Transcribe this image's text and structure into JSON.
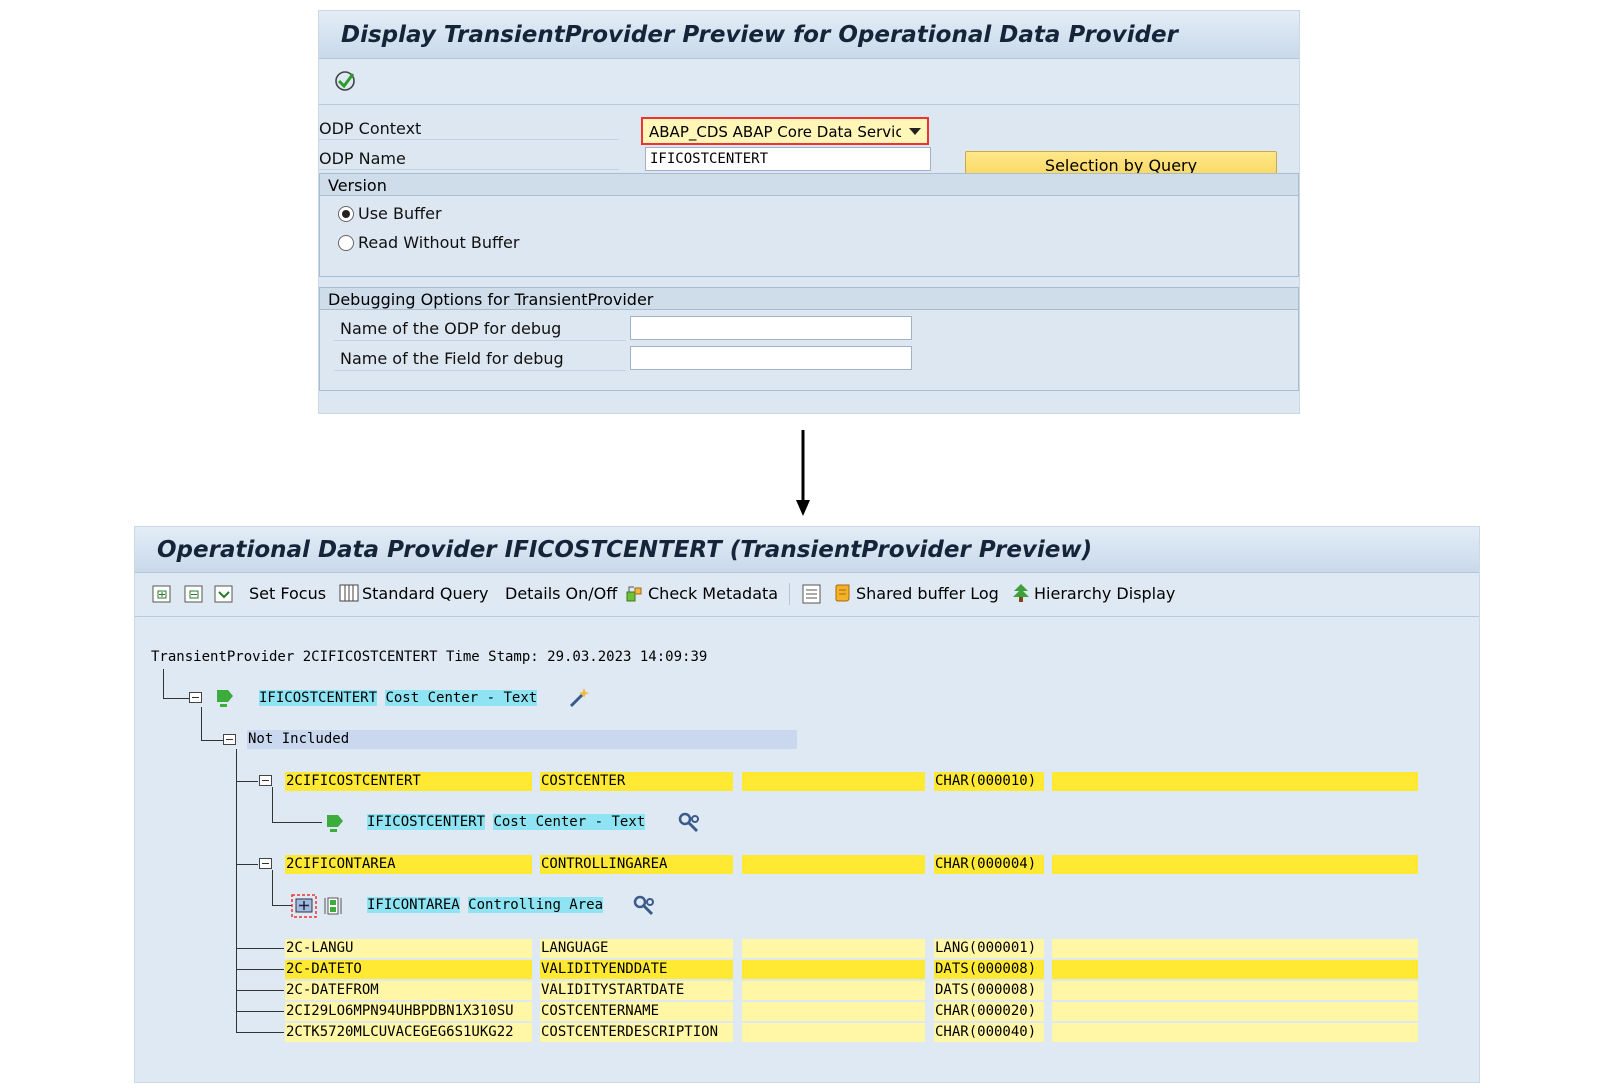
{
  "screen1": {
    "title": "Display TransientProvider Preview for Operational Data Provider",
    "toolbar": {
      "execute_icon": "execute-icon"
    },
    "odp_context": {
      "label": "ODP Context",
      "value": "ABAP_CDS ABAP Core Data Servic..."
    },
    "odp_name": {
      "label": "ODP Name",
      "value": "IFICOSTCENTERT"
    },
    "selection_button": "Selection by Query",
    "version": {
      "title": "Version",
      "options": [
        "Use Buffer",
        "Read Without Buffer"
      ],
      "selected": "Use Buffer"
    },
    "debug": {
      "title": "Debugging Options for TransientProvider",
      "odp_label": "Name of the ODP for debug",
      "field_label": "Name of the Field for debug",
      "odp_value": "",
      "field_value": ""
    }
  },
  "screen2": {
    "title": "Operational Data Provider IFICOSTCENTERT (TransientProvider Preview)",
    "toolbar": {
      "set_focus": "Set Focus",
      "standard_query": "Standard Query",
      "details": "Details On/Off",
      "check_metadata": "Check Metadata",
      "shared_buffer_log": "Shared buffer Log",
      "hierarchy_display": "Hierarchy Display"
    },
    "header_line": "TransientProvider 2CIFICOSTCENTERT Time Stamp: 29.03.2023 14:09:39",
    "root": {
      "name": "IFICOSTCENTERT",
      "desc": "Cost Center - Text"
    },
    "not_included": "Not Included",
    "rows": [
      {
        "c1": "2CIFICOSTCENTERT",
        "c2": "COSTCENTER",
        "c3": "",
        "c4": "CHAR(000010)",
        "c5": ""
      },
      {
        "c1": "2CIFICONTAREA",
        "c2": "CONTROLLINGAREA",
        "c3": "",
        "c4": "CHAR(000004)",
        "c5": ""
      },
      {
        "c1": "2C-LANGU",
        "c2": "LANGUAGE",
        "c3": "",
        "c4": "LANG(000001)",
        "c5": ""
      },
      {
        "c1": "2C-DATETO",
        "c2": "VALIDITYENDDATE",
        "c3": "",
        "c4": "DATS(000008)",
        "c5": ""
      },
      {
        "c1": "2C-DATEFROM",
        "c2": "VALIDITYSTARTDATE",
        "c3": "",
        "c4": "DATS(000008)",
        "c5": ""
      },
      {
        "c1": "2CI29LO6MPN94UHBPDBN1X310SU",
        "c2": "COSTCENTERNAME",
        "c3": "",
        "c4": "CHAR(000020)",
        "c5": ""
      },
      {
        "c1": "2CTK5720MLCUVACEGEG6S1UKG22",
        "c2": "COSTCENTERDESCRIPTION",
        "c3": "",
        "c4": "CHAR(000040)",
        "c5": ""
      }
    ],
    "child1": {
      "name": "IFICOSTCENTERT",
      "desc": "Cost Center - Text"
    },
    "child2": {
      "name": "IFICONTAREA",
      "desc": "Controlling Area"
    }
  }
}
